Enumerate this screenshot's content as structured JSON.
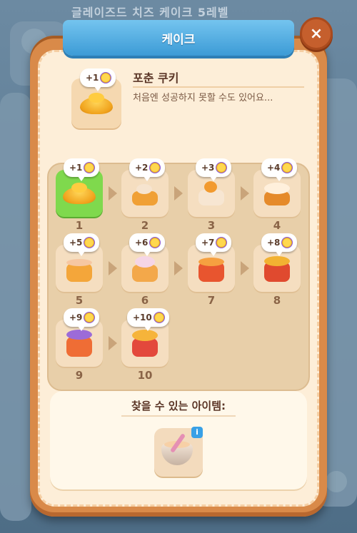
{
  "background": {
    "title": "글레이즈드 치즈 케이크 5레벨"
  },
  "panel": {
    "title": "케이크",
    "close_label": "×"
  },
  "header": {
    "name": "포춘 쿠키",
    "description": "처음엔 성공하지 못할 수도 있어요...",
    "bonus": "+1"
  },
  "levels": [
    {
      "bonus": "+1",
      "number": "1",
      "active": true
    },
    {
      "bonus": "+2",
      "number": "2"
    },
    {
      "bonus": "+3",
      "number": "3"
    },
    {
      "bonus": "+4",
      "number": "4"
    },
    {
      "bonus": "+5",
      "number": "5"
    },
    {
      "bonus": "+6",
      "number": "6"
    },
    {
      "bonus": "+7",
      "number": "7"
    },
    {
      "bonus": "+8",
      "number": "8"
    },
    {
      "bonus": "+9",
      "number": "9"
    },
    {
      "bonus": "+10",
      "number": "10"
    }
  ],
  "items": {
    "title": "찾을 수 있는 아이템:",
    "info_label": "i"
  },
  "colors": {
    "accent_blue": "#3c9bd6",
    "panel_orange": "#d98a49",
    "active_green": "#7fd94d"
  }
}
